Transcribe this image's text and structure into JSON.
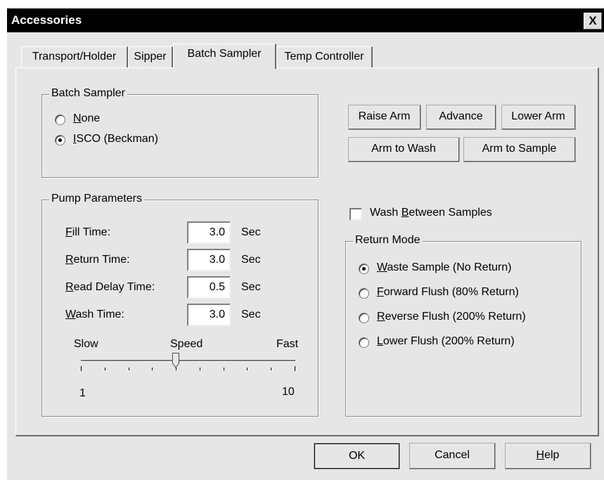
{
  "window": {
    "title": "Accessories",
    "close_label": "X"
  },
  "tabs": [
    {
      "label": "Transport/Holder",
      "active": false
    },
    {
      "label": "Sipper",
      "active": false
    },
    {
      "label": "Batch Sampler",
      "active": true
    },
    {
      "label": "Temp Controller",
      "active": false
    }
  ],
  "batch_sampler": {
    "title": "Batch Sampler",
    "options": [
      {
        "label": "None",
        "mnemonic": "N",
        "selected": false
      },
      {
        "label": "ISCO (Beckman)",
        "mnemonic": "I",
        "selected": true
      }
    ]
  },
  "arm_buttons": {
    "raise": "Raise Arm",
    "advance": "Advance",
    "lower": "Lower Arm",
    "to_wash": "Arm to Wash",
    "to_sample": "Arm to Sample"
  },
  "pump": {
    "title": "Pump Parameters",
    "fields": [
      {
        "label": "Fill Time:",
        "mnemonic": "F",
        "value": "3.0",
        "unit": "Sec"
      },
      {
        "label": "Return Time:",
        "mnemonic": "R",
        "value": "3.0",
        "unit": "Sec"
      },
      {
        "label": "Read Delay Time:",
        "mnemonic": "R",
        "value": "0.5",
        "unit": "Sec"
      },
      {
        "label": "Wash Time:",
        "mnemonic": "W",
        "value": "3.0",
        "unit": "Sec"
      }
    ],
    "speed": {
      "label": "Speed",
      "min_label": "Slow",
      "max_label": "Fast",
      "min": 1,
      "max": 10,
      "value": 5,
      "min_text": "1",
      "max_text": "10"
    }
  },
  "wash_between": {
    "label": "Wash Between Samples",
    "mnemonic": "B",
    "checked": false
  },
  "return_mode": {
    "title": "Return Mode",
    "options": [
      {
        "label": "Waste Sample (No Return)",
        "mnemonic": "W",
        "selected": true
      },
      {
        "label": "Forward Flush (80% Return)",
        "mnemonic": "F",
        "selected": false
      },
      {
        "label": "Reverse Flush (200% Return)",
        "mnemonic": "R",
        "selected": false
      },
      {
        "label": "Lower Flush (200% Return)",
        "mnemonic": "L",
        "selected": false
      }
    ]
  },
  "footer": {
    "ok": "OK",
    "cancel": "Cancel",
    "help": "Help"
  }
}
